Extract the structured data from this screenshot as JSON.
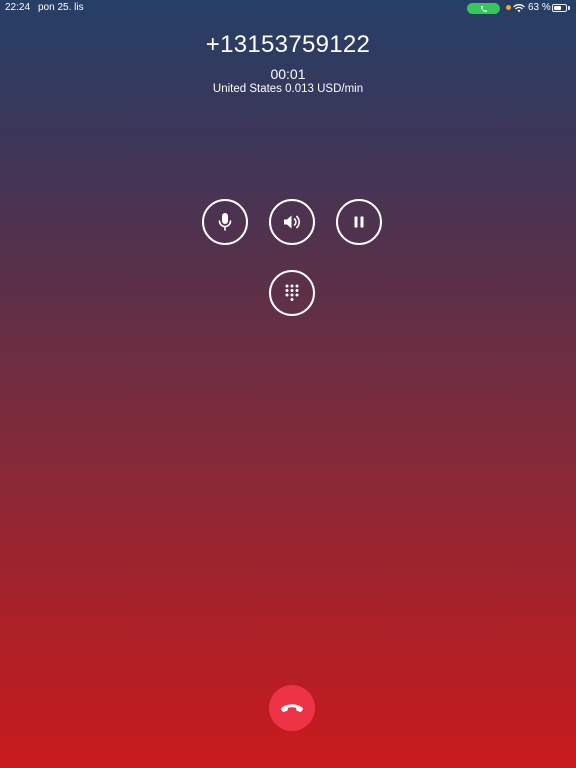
{
  "status_bar": {
    "time": "22:24",
    "date": "pon 25. lis",
    "battery_percent": "63 %",
    "battery_level": 0.63,
    "call_indicator_color": "#34c759"
  },
  "call": {
    "number": "+13153759122",
    "duration": "00:01",
    "rate": "United States 0.013 USD/min"
  },
  "controls": {
    "mute_icon": "microphone-icon",
    "speaker_icon": "speaker-icon",
    "hold_icon": "pause-icon",
    "keypad_icon": "keypad-icon",
    "end_call_icon": "phone-hangup-icon"
  },
  "colors": {
    "end_call": "#ef3347",
    "background_top": "#263f66",
    "background_bottom": "#c81a1d"
  }
}
